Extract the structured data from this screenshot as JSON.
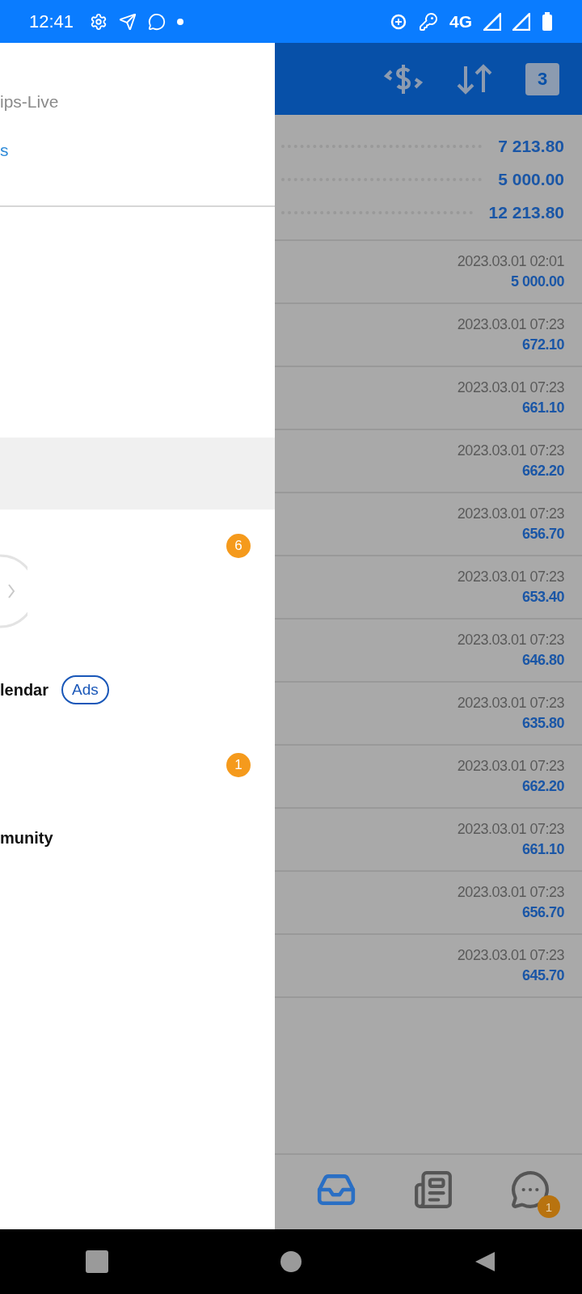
{
  "status_bar": {
    "time": "12:41",
    "network": "4G"
  },
  "drawer": {
    "account_line": "ips-Live",
    "link": "s",
    "items": [
      {
        "kind": "badge",
        "badge": "6"
      },
      {
        "kind": "label",
        "label": "lendar",
        "tag": "Ads"
      },
      {
        "kind": "badge",
        "badge": "1"
      },
      {
        "kind": "label",
        "label": "munity"
      }
    ]
  },
  "toolbar": {
    "calendar_day": "3"
  },
  "summary": [
    "7 213.80",
    "5 000.00",
    "12 213.80"
  ],
  "transactions": [
    {
      "date": "2023.03.01 02:01",
      "amount": "5 000.00"
    },
    {
      "date": "2023.03.01 07:23",
      "amount": "672.10"
    },
    {
      "date": "2023.03.01 07:23",
      "amount": "661.10"
    },
    {
      "date": "2023.03.01 07:23",
      "amount": "662.20"
    },
    {
      "date": "2023.03.01 07:23",
      "amount": "656.70"
    },
    {
      "date": "2023.03.01 07:23",
      "amount": "653.40"
    },
    {
      "date": "2023.03.01 07:23",
      "amount": "646.80"
    },
    {
      "date": "2023.03.01 07:23",
      "amount": "635.80"
    },
    {
      "date": "2023.03.01 07:23",
      "amount": "662.20"
    },
    {
      "date": "2023.03.01 07:23",
      "amount": "661.10"
    },
    {
      "date": "2023.03.01 07:23",
      "amount": "656.70"
    },
    {
      "date": "2023.03.01 07:23",
      "amount": "645.70"
    }
  ],
  "bottom_nav": [
    {
      "kind": "inbox",
      "selected": true
    },
    {
      "kind": "news",
      "selected": false
    },
    {
      "kind": "chat",
      "selected": false,
      "badge": "1"
    }
  ]
}
